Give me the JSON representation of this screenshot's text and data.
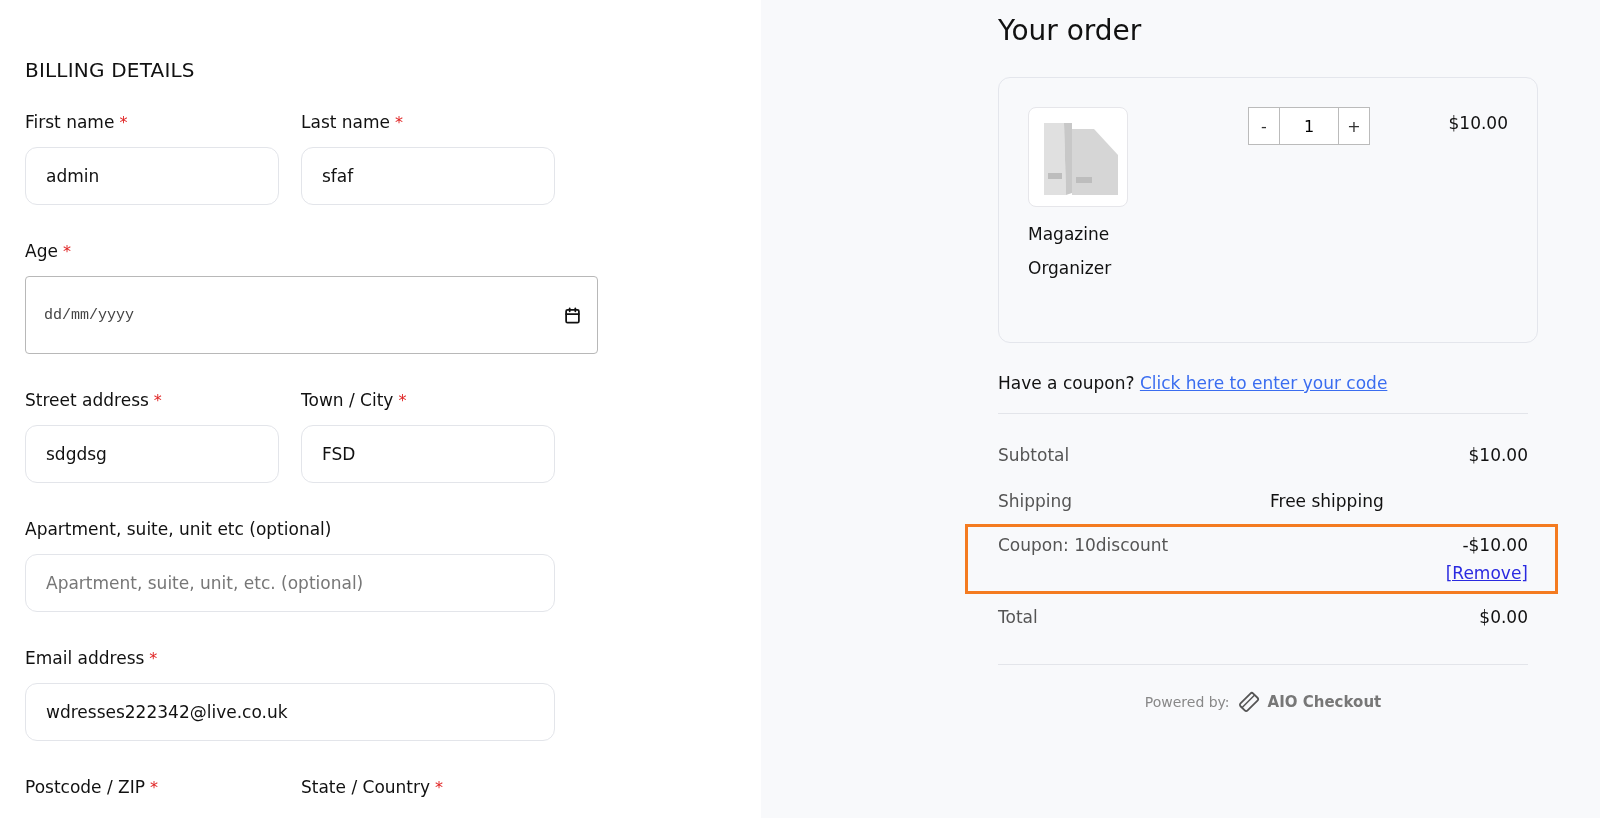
{
  "billing": {
    "title": "BILLING DETAILS",
    "rows": [
      [
        {
          "label": "First name",
          "required_mark": "*",
          "kind": "text",
          "value": "admin"
        },
        {
          "label": "Last name",
          "required_mark": "*",
          "kind": "text",
          "value": "sfaf"
        }
      ],
      [
        {
          "label": "Age",
          "required_mark": "*",
          "kind": "date",
          "placeholder": "dd/mm/yyyy"
        }
      ],
      [
        {
          "label": "Street address",
          "required_mark": "*",
          "kind": "text",
          "value": "sdgdsg"
        },
        {
          "label": "Town / City",
          "required_mark": "*",
          "kind": "text",
          "value": "FSD"
        }
      ],
      [
        {
          "label": "Apartment, suite, unit etc (optional)",
          "kind": "wide",
          "placeholder": "Apartment, suite, unit, etc. (optional)"
        }
      ],
      [
        {
          "label": "Email address",
          "required_mark": "*",
          "kind": "wide",
          "value": "wdresses222342@live.co.uk"
        }
      ],
      [
        {
          "label": "Postcode / ZIP",
          "required_mark": "*",
          "kind": "label"
        },
        {
          "label": "State / Country",
          "required_mark": "*",
          "kind": "label"
        }
      ]
    ]
  },
  "order": {
    "title": "Your order",
    "item": {
      "name": "Magazine Organizer",
      "minus": "-",
      "quantity": "1",
      "plus": "+",
      "price": "$10.00"
    },
    "coupon_prompt": {
      "text": "Have a coupon?",
      "link": "Click here to enter your code"
    },
    "totals": [
      {
        "kind": "plain",
        "label": "Subtotal",
        "value": "$10.00"
      },
      {
        "kind": "shipping",
        "label": "Shipping",
        "value": "Free shipping"
      },
      {
        "kind": "coupon",
        "label": "Coupon: 10discount",
        "value": "-$10.00",
        "action": "[Remove]",
        "highlighted": true
      },
      {
        "kind": "plain",
        "label": "Total",
        "value": "$0.00"
      }
    ],
    "footer": {
      "prefix": "Powered by:",
      "brand": "AIO Checkout"
    }
  }
}
